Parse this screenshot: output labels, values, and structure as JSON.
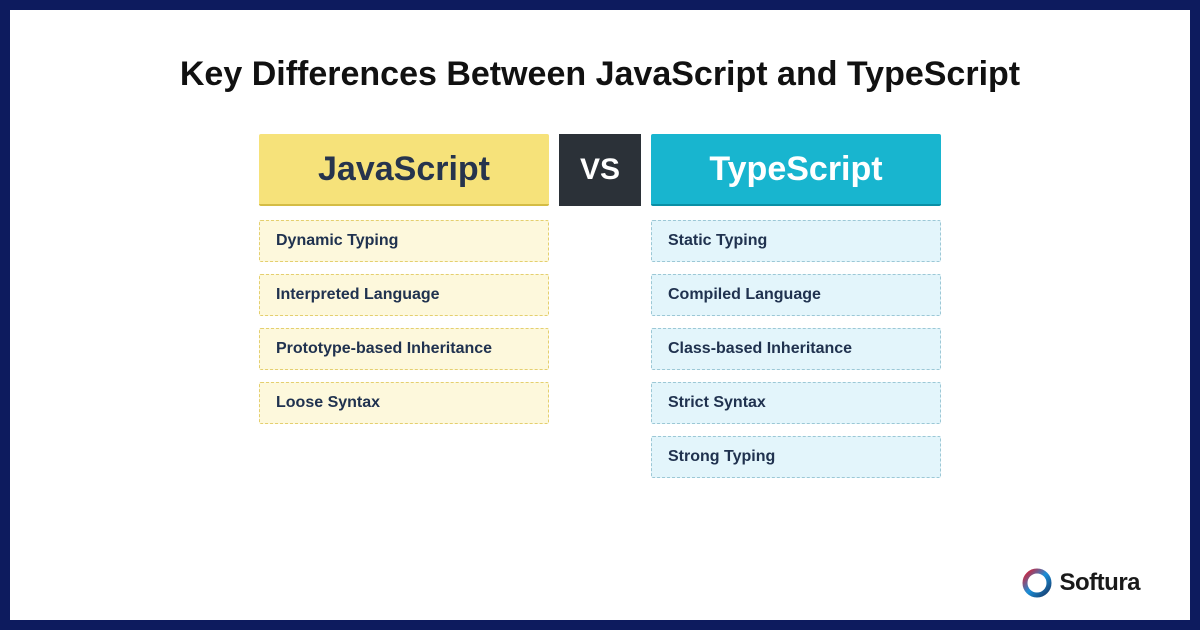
{
  "title": "Key Differences Between JavaScript and TypeScript",
  "left": {
    "header": "JavaScript",
    "items": [
      "Dynamic Typing",
      "Interpreted Language",
      "Prototype-based Inheritance",
      "Loose Syntax"
    ]
  },
  "vs": "VS",
  "right": {
    "header": "TypeScript",
    "items": [
      "Static Typing",
      "Compiled Language",
      "Class-based Inheritance",
      "Strict Syntax",
      "Strong Typing"
    ]
  },
  "brand": "Softura"
}
